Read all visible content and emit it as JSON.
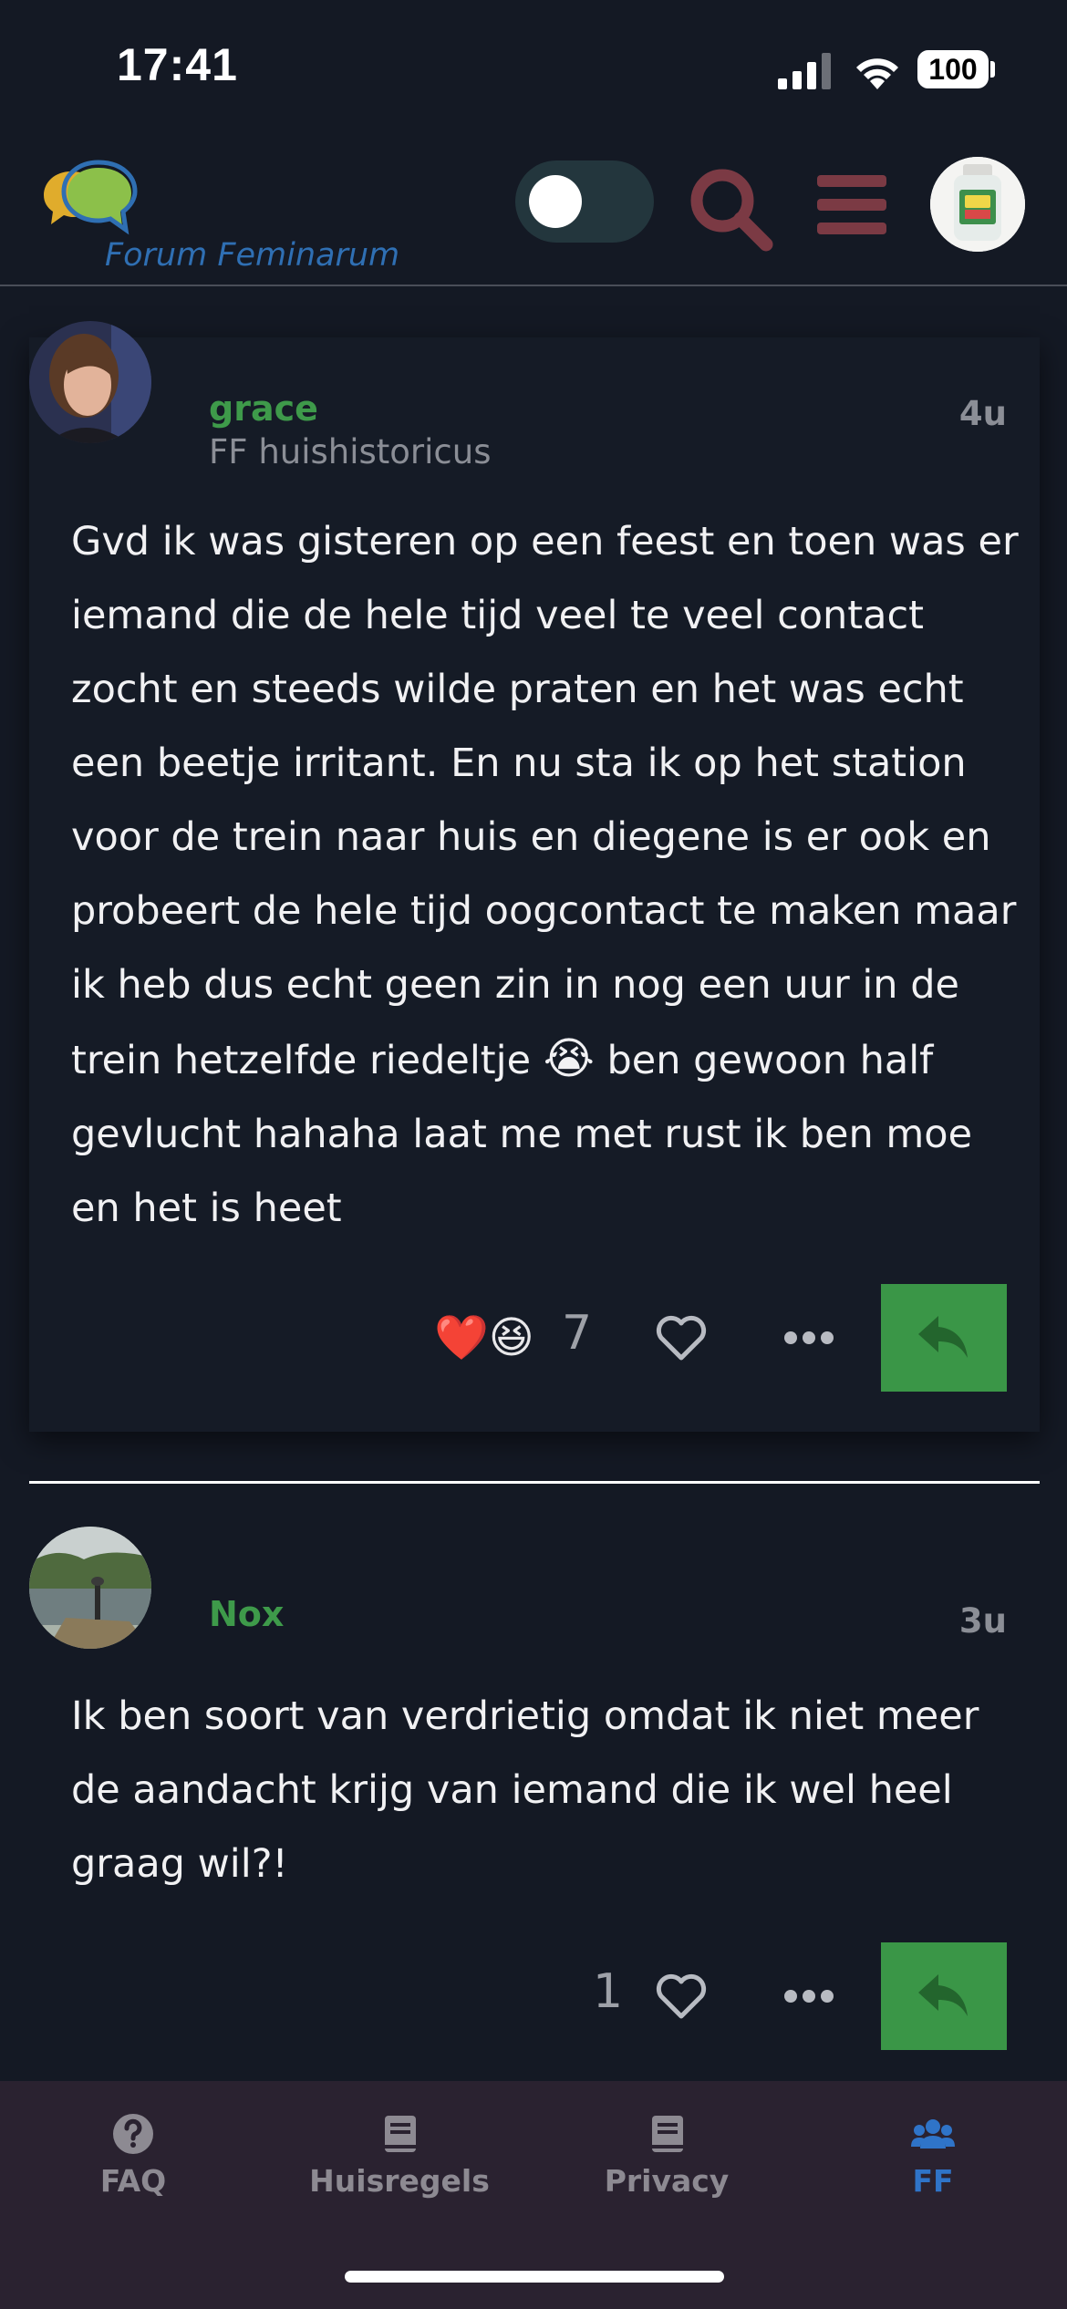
{
  "status_bar": {
    "time": "17:41",
    "battery": "100"
  },
  "header": {
    "logo_text": "Forum Feminarum",
    "theme_toggle": "on",
    "icons": [
      "search-icon",
      "hamburger-menu-icon",
      "user-avatar"
    ]
  },
  "posts": [
    {
      "username": "grace",
      "user_title": "FF huishistoricus",
      "time": "4u",
      "body_before_emoji": "Gvd ik was gisteren op een feest en toen was er iemand die de hele tijd veel te veel contact zocht en steeds wilde praten en het was echt een beetje irritant. En nu sta ik op het station voor de trein naar huis en diegene is er ook en probeert de hele tijd oogcontact te maken maar ik heb dus echt geen zin in nog een uur in de trein hetzelfde riedeltje",
      "emoji": "😭",
      "body_after_emoji": "ben gewoon half gevlucht hahaha laat me met rust ik ben moe en het is heet",
      "reactions": "❤️😆",
      "like_count": "7"
    },
    {
      "username": "Nox",
      "time": "3u",
      "body": "Ik ben soort van verdrietig omdat ik niet meer de aandacht krijg van iemand die ik wel heel graag wil?!",
      "like_count": "1"
    }
  ],
  "bottom_nav": {
    "items": [
      {
        "label": "FAQ",
        "icon": "question-circle-icon"
      },
      {
        "label": "Huisregels",
        "icon": "book-icon"
      },
      {
        "label": "Privacy",
        "icon": "book-icon"
      },
      {
        "label": "FF",
        "icon": "users-icon",
        "active": true
      }
    ]
  },
  "colors": {
    "background": "#141924",
    "accent_green": "#3a9647",
    "username_green": "#3e9a4a",
    "menu_maroon": "#7b3a44",
    "nav_active": "#2f74c8"
  }
}
